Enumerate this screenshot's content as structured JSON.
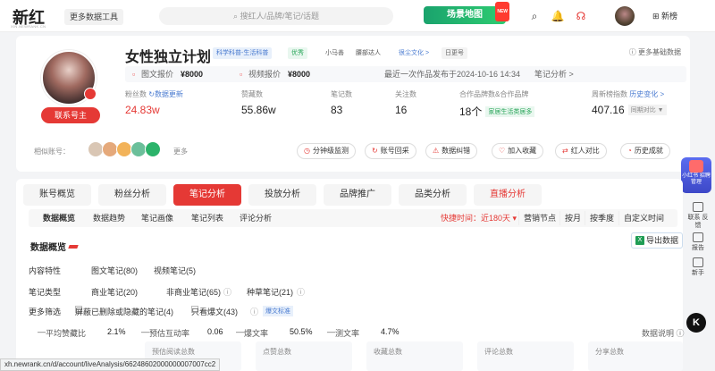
{
  "topbar": {
    "logo": "新红",
    "logo_sub": "XIN.NEWRANK.CN",
    "tools_label": "更多数据工具",
    "search_placeholder": "搜红人/品牌/笔记/话题",
    "scene_label": "场景地图",
    "scene_badge": "NEW",
    "newlist_label": "新榜"
  },
  "profile": {
    "name": "女性独立计划",
    "tags": [
      "科学科普-生活科普",
      "优秀",
      "小马善",
      "腰部达人",
      "很尘文化 >",
      "日更号"
    ],
    "more_info": "更多基础数据",
    "contact_label": "联系号主",
    "price": {
      "image_label": "图文报价",
      "image_value": "¥8000",
      "video_label": "视频报价",
      "video_value": "¥8000",
      "last_post": "最近一次作品发布于2024-10-16 14:34",
      "notes_analysis": "笔记分析 >"
    },
    "stats": {
      "fans_label": "粉丝数",
      "fans_update": "数据更新",
      "fans_value": "24.83w",
      "likes_label": "赞藏数",
      "likes_value": "55.86w",
      "notes_label": "笔记数",
      "notes_value": "83",
      "follow_label": "关注数",
      "follow_value": "16",
      "brand_label": "合作品牌数&合作品牌",
      "brand_value": "18个",
      "brand_tag": "家居生活类居多",
      "rank_label": "周新榜指数",
      "rank_link": "历史变化 >",
      "rank_value": "407.16",
      "rank_compare": "同期对比 ▼"
    },
    "similar_label": "相似账号：",
    "similar_more": "更多",
    "actions": [
      {
        "icon": "◷",
        "label": "分钟级监测"
      },
      {
        "icon": "↻",
        "label": "账号回采"
      },
      {
        "icon": "⚠",
        "label": "数据纠错"
      },
      {
        "icon": "♡",
        "label": "加入收藏"
      },
      {
        "icon": "⇄",
        "label": "红人对比"
      },
      {
        "icon": "◔",
        "label": "历史成就"
      }
    ]
  },
  "floating": {
    "badge_text": "小红书 招聘管理"
  },
  "right_side": [
    {
      "label": "联系 反馈"
    },
    {
      "label": "报告"
    },
    {
      "label": "新手"
    }
  ],
  "tabs": [
    "账号概览",
    "粉丝分析",
    "笔记分析",
    "投放分析",
    "品牌推广",
    "品类分析",
    "直播分析"
  ],
  "subnav": {
    "items": [
      "数据概览",
      "数据趋势",
      "笔记画像",
      "笔记列表",
      "评论分析"
    ],
    "quick_label": "快捷时间：",
    "quick_value": "近180天 ▾",
    "ranges": [
      "营销节点",
      "按月",
      "按季度",
      "自定义时间"
    ]
  },
  "overview": {
    "title": "数据概览",
    "export_label": "导出数据",
    "content_label": "内容特性",
    "content_items": [
      "图文笔记(80)",
      "视频笔记(5)"
    ],
    "type_label": "笔记类型",
    "type_items": [
      "商业笔记(20)",
      "非商业笔记(65)",
      "种草笔记(21)"
    ],
    "filter_label": "更多筛选",
    "filter_items": [
      "屏蔽已删除或隐藏的笔记(4)",
      "只看爆文(43)"
    ],
    "filter_pill": "爆文标准",
    "metrics": [
      {
        "label": "平均赞藏比",
        "value": "2.1%"
      },
      {
        "label": "预估互动率",
        "value": "0.06"
      },
      {
        "label": "爆文率",
        "value": "50.5%"
      },
      {
        "label": "测文率",
        "value": "4.7%"
      }
    ],
    "data_desc": "数据说明 ⓘ",
    "boxes": [
      "预估阅读总数",
      "点赞总数",
      "收藏总数",
      "评论总数",
      "分享总数"
    ]
  },
  "status_url": "xh.newrank.cn/d/account/liveAnalysis/66248602000000007007cc2"
}
